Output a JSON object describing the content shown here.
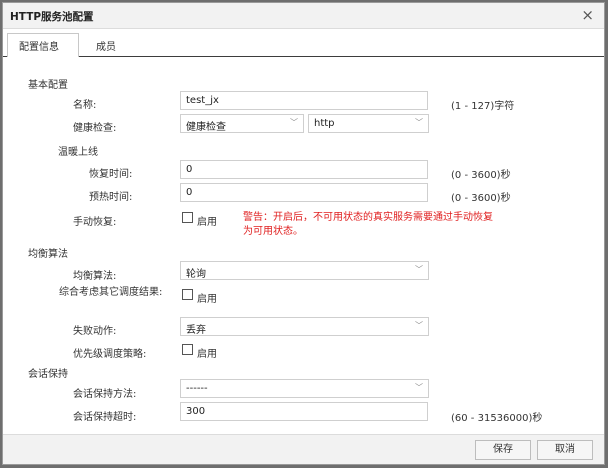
{
  "dialog": {
    "title": "HTTP服务池配置",
    "close_symbol": "×"
  },
  "tabs": [
    {
      "label": "配置信息",
      "active": true
    },
    {
      "label": "成员",
      "active": false
    }
  ],
  "basic": {
    "section_label": "基本配置",
    "name": {
      "label": "名称:",
      "value": "test_jx",
      "hint": "(1 - 127)字符"
    },
    "health_check": {
      "label": "健康检查:",
      "value": "健康检查",
      "protocol": "http"
    },
    "warmup": {
      "section_label": "温暖上线",
      "recover_time": {
        "label": "恢复时间:",
        "value": "0",
        "hint": "(0 - 3600)秒"
      },
      "preheat_time": {
        "label": "预热时间:",
        "value": "0",
        "hint": "(0 - 3600)秒"
      }
    },
    "manual_recover": {
      "label": "手动恢复:",
      "checkbox_label": "启用",
      "checked": false,
      "warning": "警告：开启后，不可用状态的真实服务需要通过手动恢复为可用状态。"
    }
  },
  "balance": {
    "section_label": "均衡算法",
    "algorithm": {
      "label": "均衡算法:",
      "value": "轮询"
    },
    "consider_other": {
      "label": "综合考虑其它调度结果:",
      "checkbox_label": "启用",
      "checked": false
    },
    "fail_action": {
      "label": "失败动作:",
      "value": "丢弃"
    },
    "priority": {
      "label": "优先级调度策略:",
      "checkbox_label": "启用",
      "checked": false
    }
  },
  "session": {
    "section_label": "会话保持",
    "method": {
      "label": "会话保持方法:",
      "value": "------"
    },
    "timeout": {
      "label": "会话保持超时:",
      "value": "300",
      "hint": "(60 - 31536000)秒"
    }
  },
  "footer": {
    "save_label": "保存",
    "cancel_label": "取消"
  },
  "icons": {
    "chevron": "chevron-down-icon",
    "close": "close-icon"
  }
}
